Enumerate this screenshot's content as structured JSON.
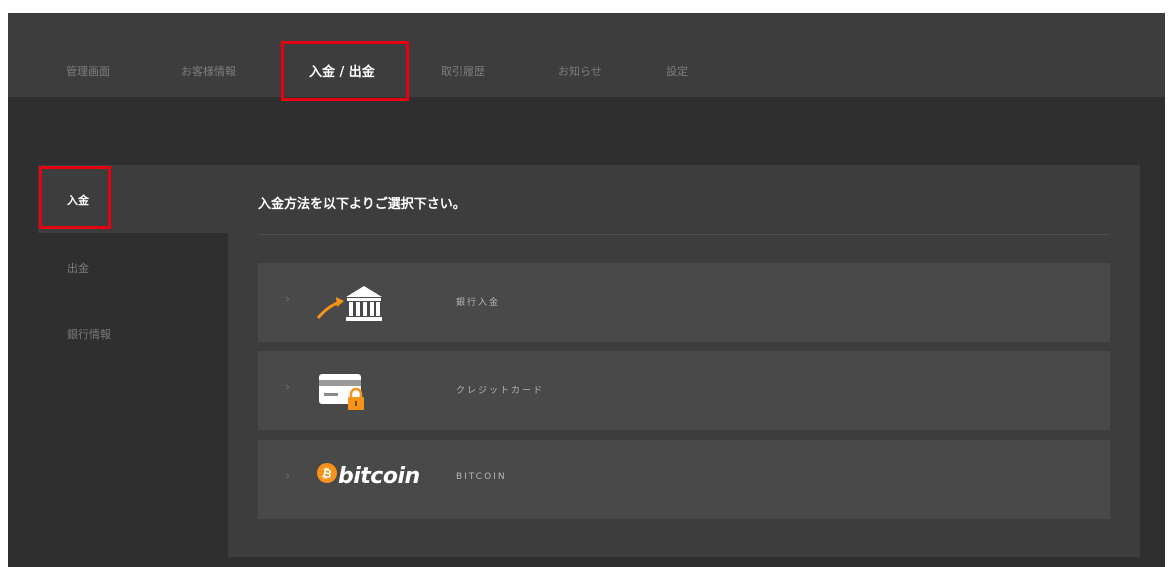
{
  "topnav": {
    "items": [
      {
        "label": "管理画面"
      },
      {
        "label": "お客様情報"
      },
      {
        "label": "入金 / 出金"
      },
      {
        "label": "取引履歴"
      },
      {
        "label": "お知らせ"
      },
      {
        "label": "設定"
      }
    ],
    "active_index": 2
  },
  "sidebar": {
    "items": [
      {
        "label": "入金"
      },
      {
        "label": "出金"
      },
      {
        "label": "銀行情報"
      }
    ],
    "active_index": 0
  },
  "main": {
    "heading": "入金方法を以下よりご選択下さい。",
    "options": [
      {
        "icon": "bank-icon",
        "label": "銀行入金"
      },
      {
        "icon": "credit-card-lock-icon",
        "label": "クレジットカード"
      },
      {
        "icon": "bitcoin-logo",
        "logo_text": "bitcoin",
        "label": "BITCOIN"
      }
    ]
  },
  "colors": {
    "highlight": "#e60012",
    "accent_orange": "#f7931a",
    "background": "#2f2f2f",
    "panel": "#3d3d3d",
    "option_bg": "#494949"
  }
}
